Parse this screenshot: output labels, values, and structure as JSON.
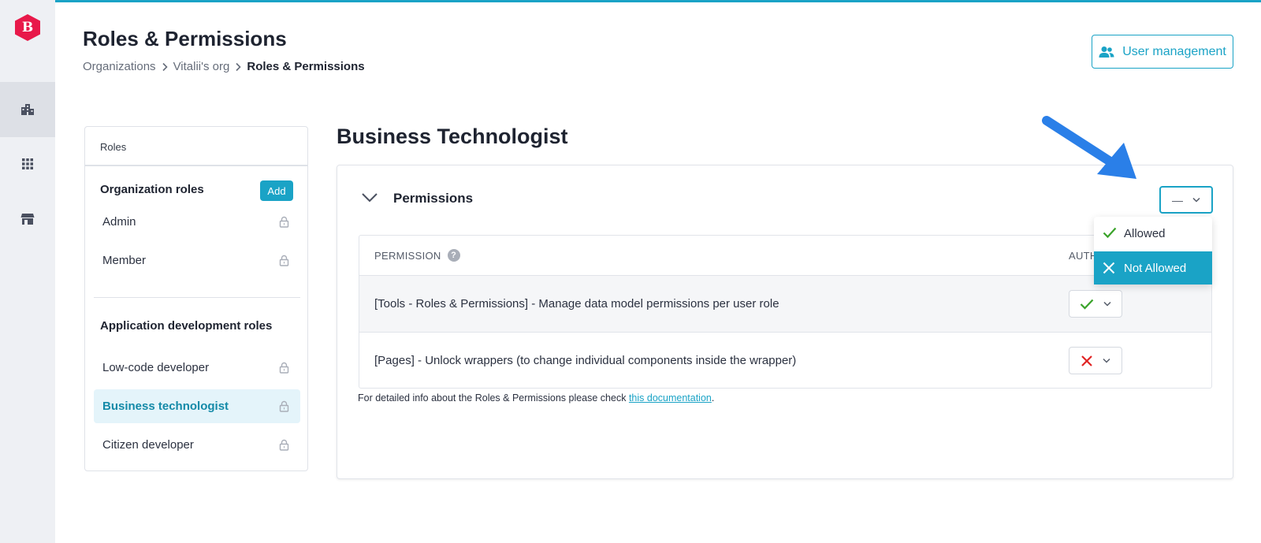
{
  "app": {
    "logo_letter": "B",
    "logo_color": "#e8194a",
    "accent_color": "#1aa3c6"
  },
  "rail": {
    "items": [
      {
        "icon": "building-icon",
        "active": true
      },
      {
        "icon": "apps-grid-icon",
        "active": false
      },
      {
        "icon": "store-icon",
        "active": false
      }
    ]
  },
  "header": {
    "title": "Roles & Permissions",
    "breadcrumb": [
      "Organizations",
      "Vitalii's org",
      "Roles & Permissions"
    ],
    "user_management_label": "User management"
  },
  "roles": {
    "panel_title": "Roles",
    "org_group_title": "Organization roles",
    "add_label": "Add",
    "org_roles": [
      {
        "label": "Admin",
        "locked": true
      },
      {
        "label": "Member",
        "locked": true
      }
    ],
    "app_group_title": "Application development roles",
    "app_roles": [
      {
        "label": "Low-code developer",
        "locked": true,
        "active": false
      },
      {
        "label": "Business technologist",
        "locked": true,
        "active": true
      },
      {
        "label": "Citizen developer",
        "locked": true,
        "active": false
      }
    ]
  },
  "main": {
    "role_title": "Business Technologist",
    "section_title": "Permissions",
    "bulk_select_value": "—",
    "table": {
      "col_permission": "PERMISSION",
      "col_authorization": "AUTH",
      "rows": [
        {
          "label": "[Tools - Roles & Permissions] - Manage data model permissions per user role",
          "value": "allowed"
        },
        {
          "label": "[Pages] - Unlock wrappers (to change individual components inside the wrapper)",
          "value": "not_allowed"
        }
      ]
    },
    "footnote_prefix": "For detailed info about the Roles & Permissions please check ",
    "footnote_link": "this documentation",
    "footnote_suffix": "."
  },
  "dropdown": {
    "options": [
      {
        "label": "Allowed",
        "icon": "check-icon",
        "selected": false
      },
      {
        "label": "Not Allowed",
        "icon": "close-icon",
        "selected": true
      }
    ]
  },
  "colors": {
    "allowed": "#3aa32a",
    "not_allowed": "#e02424",
    "annotation_arrow": "#2a7fe8"
  }
}
